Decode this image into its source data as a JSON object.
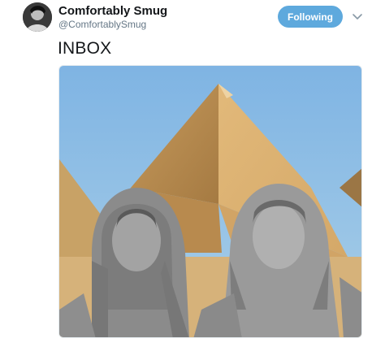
{
  "author": {
    "display_name": "Comfortably Smug",
    "handle": "@ComfortablySmug",
    "avatar_icon": "user-avatar"
  },
  "actions": {
    "follow_label": "Following",
    "menu_icon": "chevron-down-icon"
  },
  "tweet": {
    "text": "INBOX"
  },
  "media": {
    "description_icon": "photo-image"
  },
  "colors": {
    "follow_bg": "#5ea9dd",
    "handle": "#657786",
    "text": "#14171a"
  }
}
